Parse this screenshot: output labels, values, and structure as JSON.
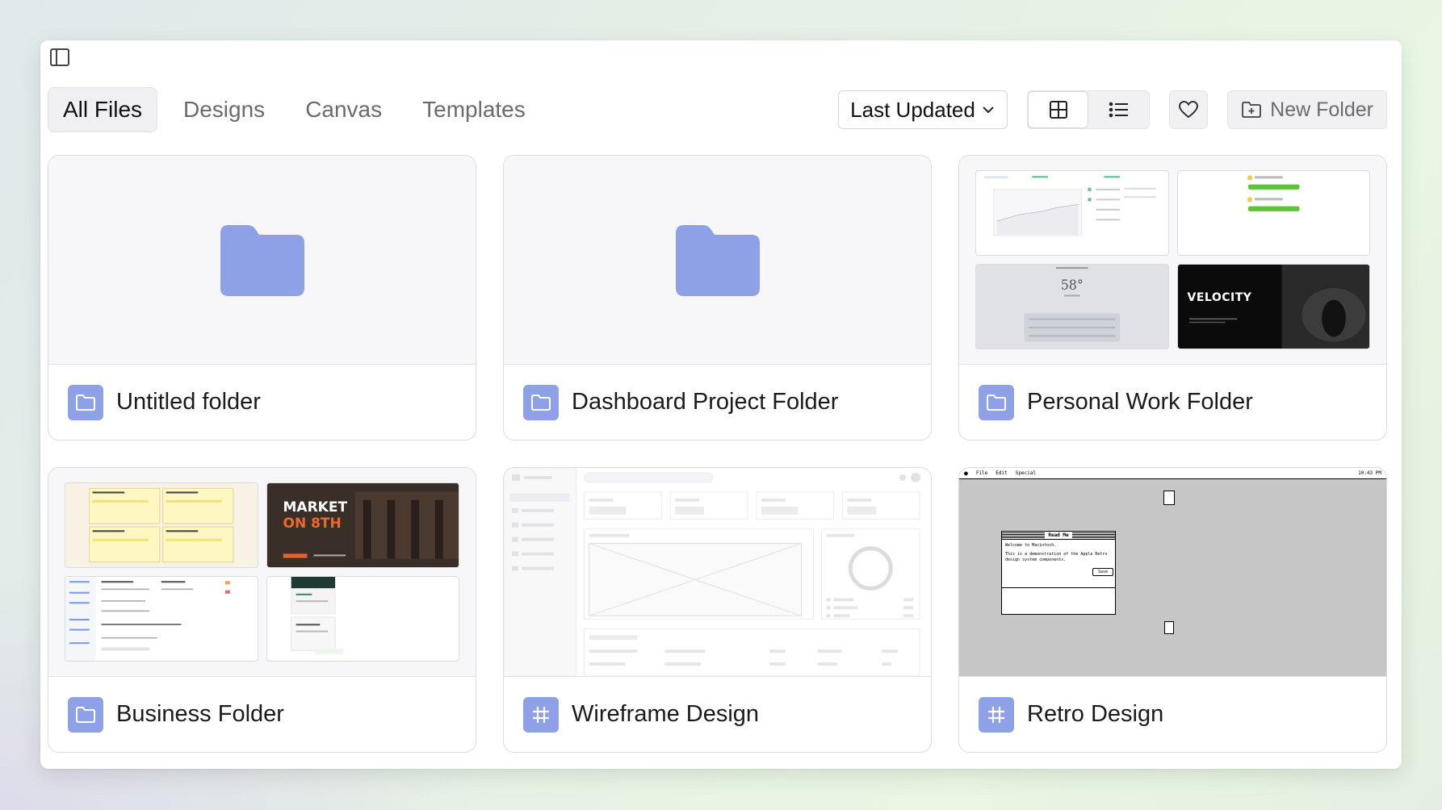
{
  "tabs": [
    {
      "label": "All Files",
      "active": true
    },
    {
      "label": "Designs",
      "active": false
    },
    {
      "label": "Canvas",
      "active": false
    },
    {
      "label": "Templates",
      "active": false
    }
  ],
  "sort": {
    "label": "Last Updated"
  },
  "new_folder": {
    "label": "New Folder"
  },
  "colors": {
    "accent": "#8fa1e6",
    "folder": "#8fa1e6"
  },
  "cards": [
    {
      "title": "Untitled folder",
      "type": "folder-icon"
    },
    {
      "title": "Dashboard Project Folder",
      "type": "folder-icon"
    },
    {
      "title": "Personal Work Folder",
      "type": "folder-icon"
    },
    {
      "title": "Business Folder",
      "type": "folder-icon"
    },
    {
      "title": "Wireframe Design",
      "type": "hash-icon"
    },
    {
      "title": "Retro Design",
      "type": "hash-icon"
    }
  ],
  "thumbnails": {
    "weather_temp": "58°",
    "velocity": "VELOCITY",
    "market_line1": "MARKET",
    "market_line2": "ON 8TH",
    "retro_menu": [
      "File",
      "Edit",
      "Special"
    ],
    "retro_time": "10:43 PM",
    "retro_window_title": "Read Me",
    "retro_line1": "Welcome to Macintosh.",
    "retro_line2": "This is a demonstration of the Apple Retro",
    "retro_line3": "design system components.",
    "retro_button": "Save"
  }
}
